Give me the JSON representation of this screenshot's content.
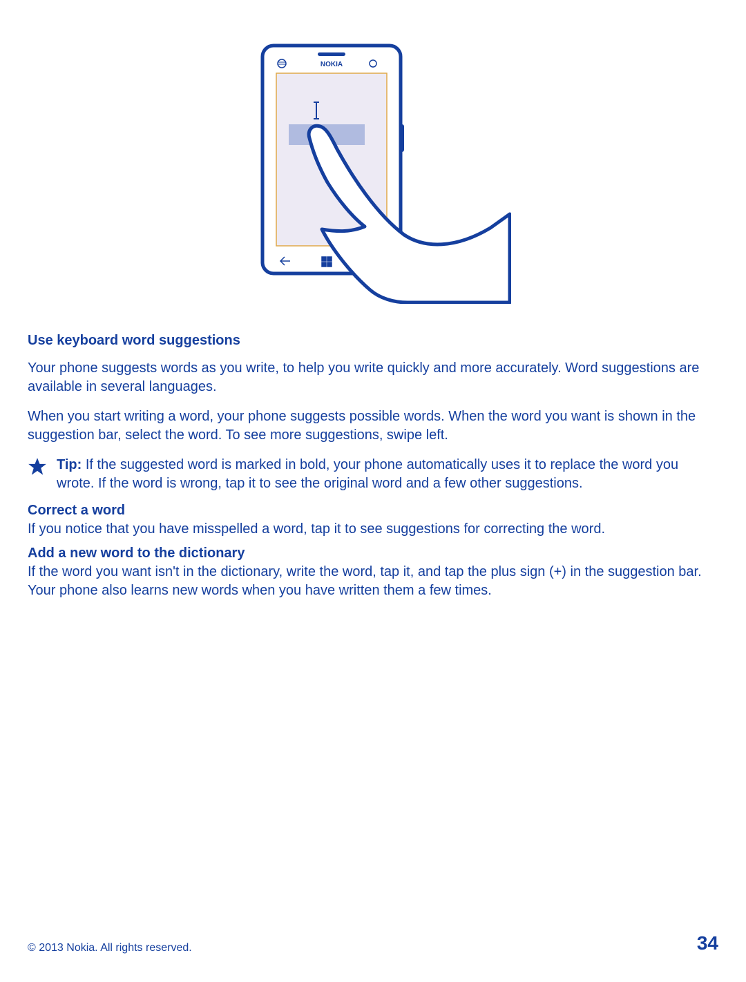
{
  "illustration": {
    "brand": "NOKIA"
  },
  "sections": {
    "use_suggestions": {
      "heading": "Use keyboard word suggestions",
      "p1": "Your phone suggests words as you write, to help you write quickly and more accurately. Word suggestions are available in several languages.",
      "p2": "When you start writing a word, your phone suggests possible words. When the word you want is shown in the suggestion bar, select the word. To see more suggestions, swipe left."
    },
    "tip": {
      "label": "Tip:",
      "text": " If the suggested word is marked in bold, your phone automatically uses it to replace the word you wrote. If the word is wrong, tap it to see the original word and a few other suggestions."
    },
    "correct": {
      "heading": "Correct a word",
      "body": "If you notice that you have misspelled a word, tap it to see suggestions for correcting the word."
    },
    "add_word": {
      "heading": "Add a new word to the dictionary",
      "body": "If the word you want isn't in the dictionary, write the word, tap it, and tap the plus sign (+) in the suggestion bar. Your phone also learns new words when you have written them a few times."
    }
  },
  "footer": {
    "copyright": "© 2013 Nokia. All rights reserved.",
    "page_number": "34"
  }
}
